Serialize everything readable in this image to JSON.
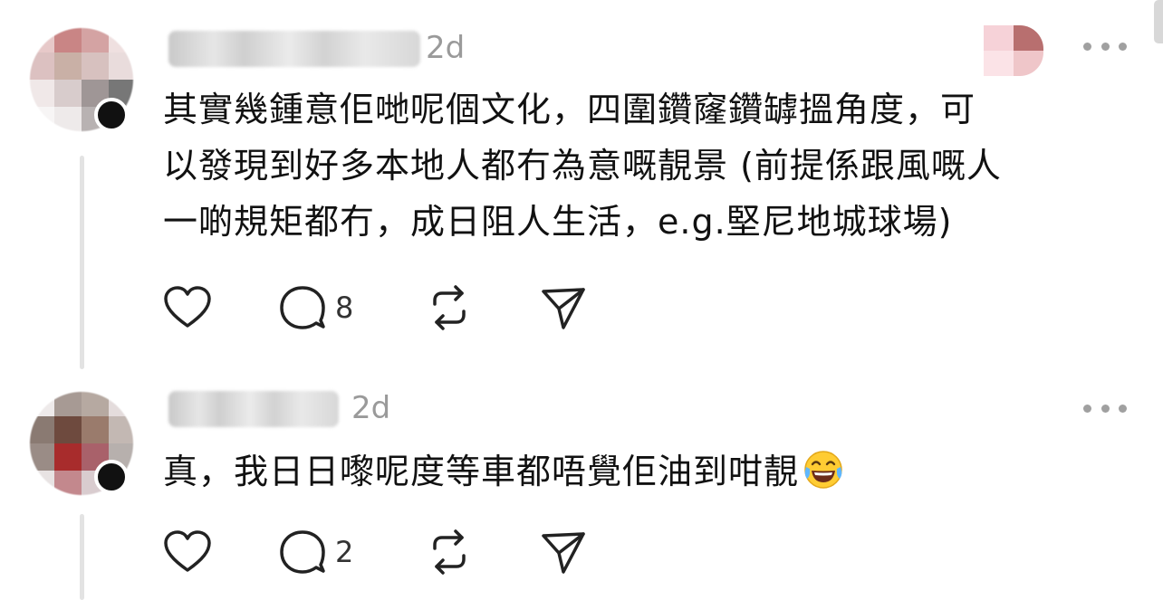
{
  "comments": [
    {
      "timestamp": "2d",
      "text": "其實幾鍾意佢哋呢個文化，四圍鑽窿鑽罅搵角度，可\n以發現到好多本地人都冇為意嘅靚景 (前提係跟風嘅人\n一啲規矩都冇，成日阻人生活，e.g.堅尼地城球場)",
      "reply_count": "8",
      "icons": [
        "heart-icon",
        "comment-icon",
        "repost-icon",
        "share-icon"
      ]
    },
    {
      "timestamp": "2d",
      "text": "真，我日日嚟呢度等車都唔覺佢油到咁靚",
      "emoji": "face-with-tears-of-joy",
      "reply_count": "2",
      "icons": [
        "heart-icon",
        "comment-icon",
        "repost-icon",
        "share-icon"
      ]
    }
  ],
  "colors": {
    "text": "#111111",
    "timestamp": "#9a9a9a",
    "icon": "#222222",
    "thread_line": "#e3e3e3",
    "more_dots": "#a0a0a0"
  }
}
